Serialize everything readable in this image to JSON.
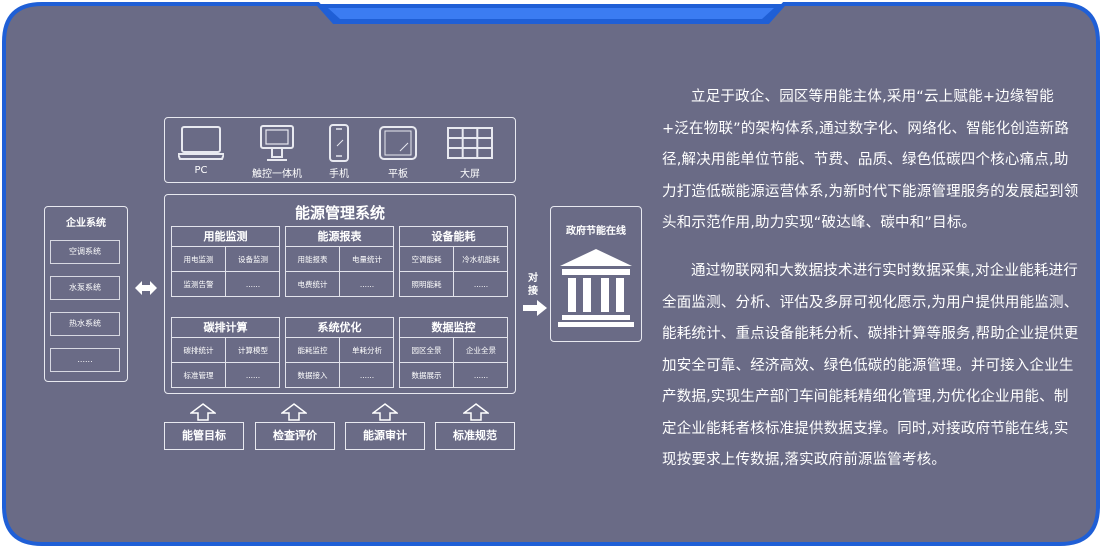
{
  "colors": {
    "panel": "#6a6b86",
    "border": "#1f5fd6",
    "line": "#e8e9f0"
  },
  "devices": [
    {
      "icon": "pc-icon",
      "label": "PC"
    },
    {
      "icon": "kiosk-icon",
      "label": "触控一体机"
    },
    {
      "icon": "phone-icon",
      "label": "手机"
    },
    {
      "icon": "tablet-icon",
      "label": "平板"
    },
    {
      "icon": "big-screen-icon",
      "label": "大屏"
    }
  ],
  "enterprise": {
    "title": "企业系统",
    "items": [
      "空调系统",
      "水泵系统",
      "热水系统",
      "......"
    ]
  },
  "system": {
    "title": "能源管理系统",
    "groups": [
      {
        "title": "用能监测",
        "cells": [
          "用电监测",
          "设备监测",
          "监测告警",
          "......"
        ]
      },
      {
        "title": "能源报表",
        "cells": [
          "用能报表",
          "电量统计",
          "电费统计",
          "......"
        ]
      },
      {
        "title": "设备能耗",
        "cells": [
          "空调能耗",
          "冷水机能耗",
          "照明能耗",
          "......"
        ]
      },
      {
        "title": "碳排计算",
        "cells": [
          "碳排统计",
          "计算模型",
          "标准管理",
          "......"
        ]
      },
      {
        "title": "系统优化",
        "cells": [
          "能耗监控",
          "单耗分析",
          "数据接入",
          "......"
        ]
      },
      {
        "title": "数据监控",
        "cells": [
          "园区全景",
          "企业全景",
          "数据展示",
          "......"
        ]
      }
    ]
  },
  "connect_label": "对接",
  "gov": {
    "title": "政府节能在线"
  },
  "bottom": [
    "能管目标",
    "检查评价",
    "能源审计",
    "标准规范"
  ],
  "text": {
    "p1": "立足于政企、园区等用能主体,采用“云上赋能+边缘智能+泛在物联”的架构体系,通过数字化、网络化、智能化创造新路径,解决用能单位节能、节费、品质、绿色低碳四个核心痛点,助力打造低碳能源运营体系,为新时代下能源管理服务的发展起到领头和示范作用,助力实现“破达峰、碳中和”目标。",
    "p2": "通过物联网和大数据技术进行实时数据采集,对企业能耗进行全面监测、分析、评估及多屏可视化愿示,为用户提供用能监测、能耗统计、重点设备能耗分析、碳排计算等服务,帮助企业提供更加安全可靠、经济高效、绿色低碳的能源管理。并可接入企业生产数据,实现生产部门车间能耗精细化管理,为优化企业用能、制定企业能耗者核标准提供数据支撑。同时,对接政府节能在线,实现按要求上传数据,落实政府前源监管考核。"
  }
}
